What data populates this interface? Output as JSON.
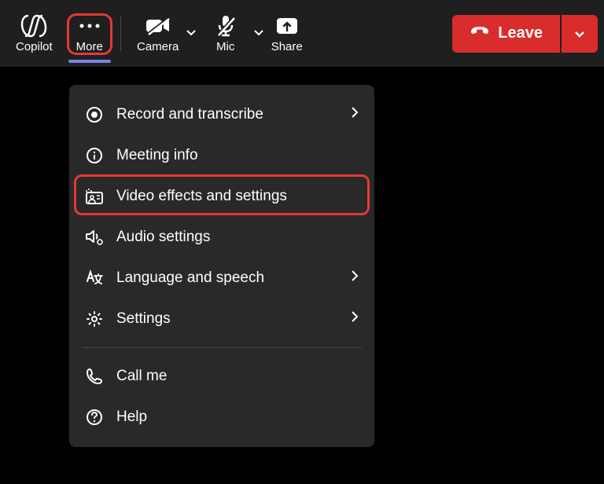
{
  "toolbar": {
    "copilot_label": "Copilot",
    "more_label": "More",
    "camera_label": "Camera",
    "mic_label": "Mic",
    "share_label": "Share",
    "leave_label": "Leave"
  },
  "menu": {
    "items": [
      {
        "label": "Record and transcribe",
        "has_chevron": true
      },
      {
        "label": "Meeting info",
        "has_chevron": false
      },
      {
        "label": "Video effects and settings",
        "has_chevron": false
      },
      {
        "label": "Audio settings",
        "has_chevron": false
      },
      {
        "label": "Language and speech",
        "has_chevron": true
      },
      {
        "label": "Settings",
        "has_chevron": true
      }
    ],
    "footer_items": [
      {
        "label": "Call me"
      },
      {
        "label": "Help"
      }
    ]
  }
}
